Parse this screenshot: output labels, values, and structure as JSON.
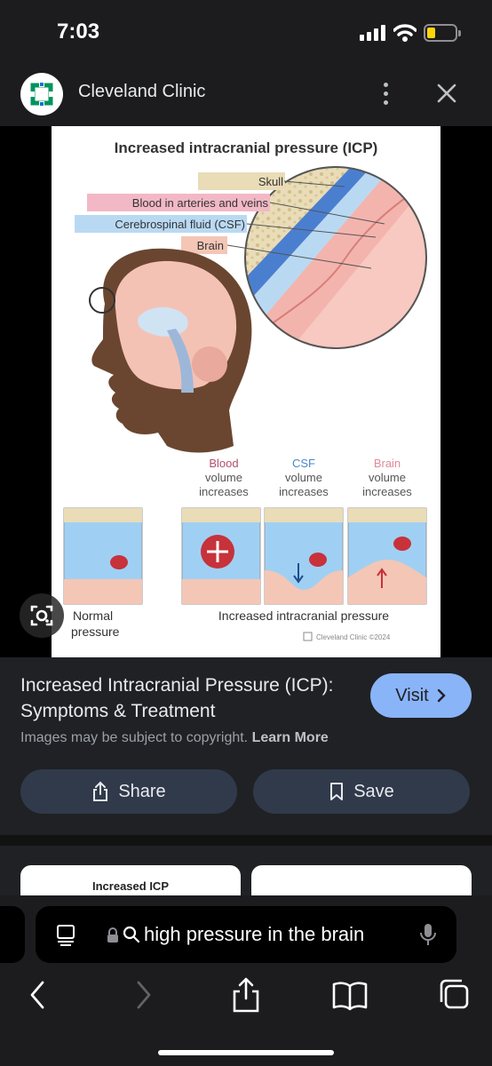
{
  "status_bar": {
    "time": "7:03"
  },
  "header": {
    "source_name": "Cleveland Clinic",
    "brand_color": "#00945d"
  },
  "figure": {
    "title": "Increased intracranial pressure (ICP)",
    "labels": {
      "skull": "Skull",
      "blood": "Blood in arteries and veins",
      "csf": "Cerebrospinal fluid (CSF)",
      "brain": "Brain"
    },
    "panel_headings": [
      [
        "Blood",
        "volume",
        "increases"
      ],
      [
        "CSF",
        "volume",
        "increases"
      ],
      [
        "Brain",
        "volume",
        "increases"
      ]
    ],
    "normal_label": [
      "Normal",
      "pressure"
    ],
    "increased_label": "Increased intracranial pressure",
    "credit": "Cleveland Clinic ©2024",
    "colors": {
      "skull": "#e9dcb7",
      "blood": "#f2b8c6",
      "csf": "#b9d9f3",
      "brain": "#f4c6b6",
      "fluid": "#9fd0f3"
    }
  },
  "details": {
    "title": "Increased Intracranial Pressure (ICP): Symptoms & Treatment",
    "visit_label": "Visit",
    "copyright_text": "Images may be subject to copyright.",
    "learn_more": "Learn More",
    "share_label": "Share",
    "save_label": "Save",
    "accent_color": "#8ab4f8"
  },
  "related": [
    {
      "label": "Increased ICP"
    },
    {
      "label": ""
    }
  ],
  "browser": {
    "address_text": "high pressure in the brain"
  }
}
